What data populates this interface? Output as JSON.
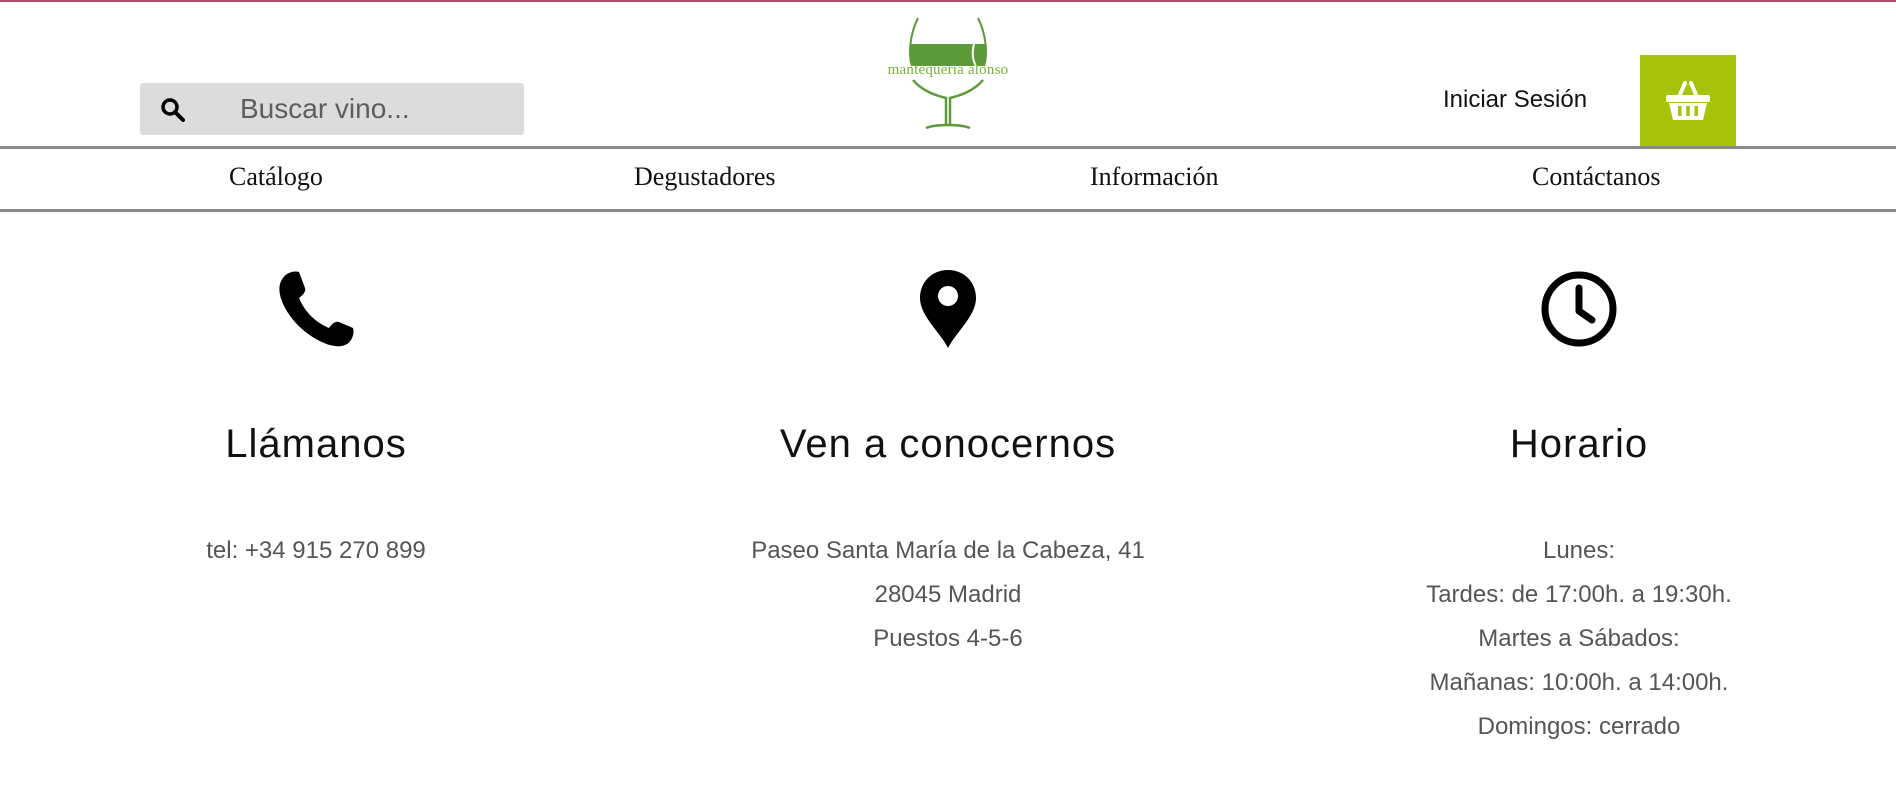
{
  "colors": {
    "accent_green": "#a6c20a",
    "logo_green": "#7ab03a",
    "top_line": "#b0486f"
  },
  "header": {
    "search": {
      "placeholder": "Buscar vino...",
      "icon": "search-icon"
    },
    "logo": {
      "text": "mantequería alonso"
    },
    "login_label": "Iniciar Sesión",
    "cart_icon": "basket-icon"
  },
  "nav": {
    "items": [
      {
        "label": "Catálogo"
      },
      {
        "label": "Degustadores"
      },
      {
        "label": "Información"
      },
      {
        "label": "Contáctanos"
      }
    ]
  },
  "contact": {
    "columns": [
      {
        "icon": "phone-icon",
        "title": "Llámanos",
        "lines": [
          "tel: +34 915 270 899"
        ]
      },
      {
        "icon": "map-pin-icon",
        "title": "Ven a conocernos",
        "lines": [
          "Paseo Santa María de la Cabeza, 41",
          "28045 Madrid",
          "Puestos 4-5-6"
        ]
      },
      {
        "icon": "clock-icon",
        "title": "Horario",
        "lines": [
          "Lunes:",
          "Tardes: de 17:00h. a 19:30h.",
          "Martes a Sábados:",
          "Mañanas: 10:00h. a 14:00h.",
          "Domingos: cerrado"
        ]
      }
    ]
  }
}
